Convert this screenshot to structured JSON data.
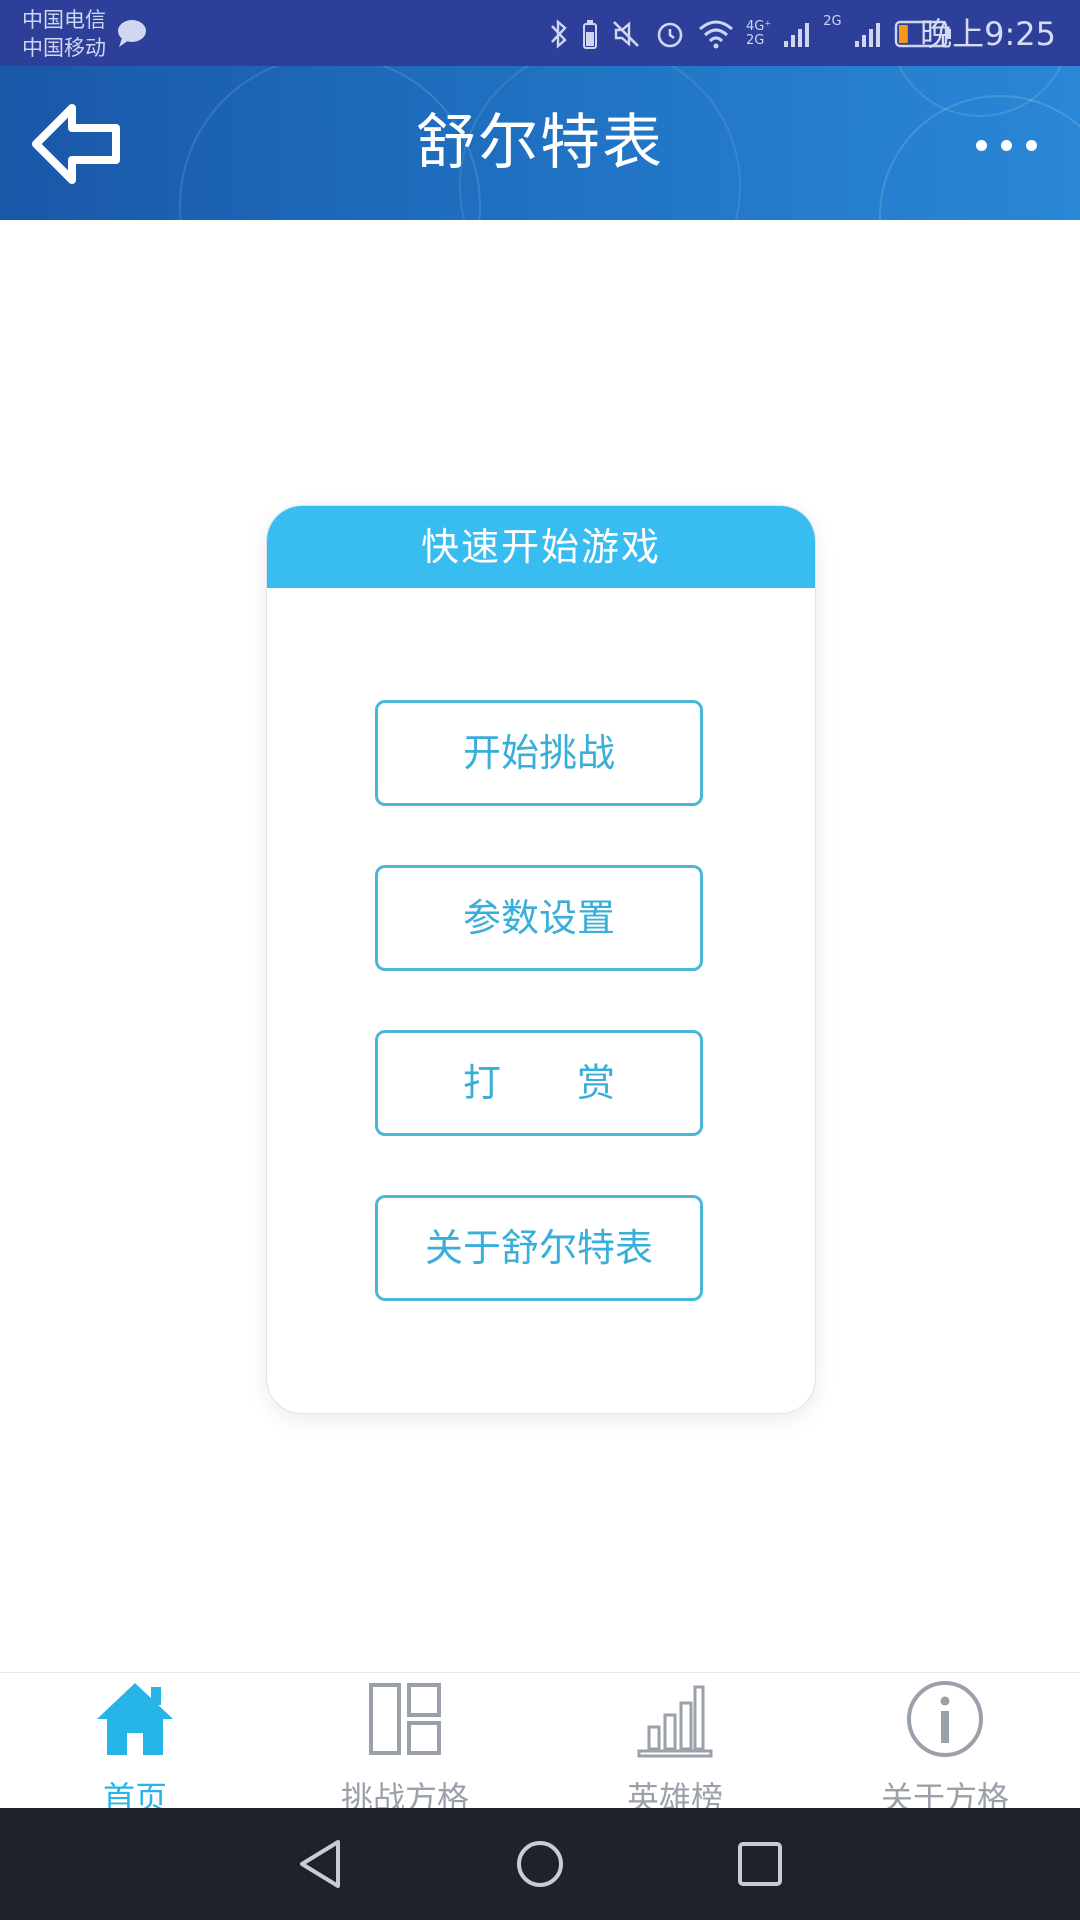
{
  "status_bar": {
    "carrier_1": "中国电信",
    "carrier_2": "中国移动",
    "time": "晚上9:25",
    "network_1": "4G⁺",
    "network_2": "2G",
    "network_3": "2G",
    "icons": [
      "chat-icon",
      "bluetooth-icon",
      "battery-small-icon",
      "mute-icon",
      "alarm-icon",
      "wifi-icon",
      "signal-icon",
      "signal-icon",
      "battery-icon"
    ],
    "battery_level": 0.2
  },
  "header": {
    "title": "舒尔特表",
    "back_icon": "back-arrow-icon",
    "more_icon": "more-dots-icon"
  },
  "card": {
    "title": "快速开始游戏",
    "buttons": [
      {
        "label": "开始挑战"
      },
      {
        "label": "参数设置"
      },
      {
        "label": "打　　赏"
      },
      {
        "label": "关于舒尔特表"
      }
    ]
  },
  "tabs": [
    {
      "label": "首页",
      "icon": "home-icon",
      "active": true
    },
    {
      "label": "挑战方格",
      "icon": "grid-layout-icon",
      "active": false
    },
    {
      "label": "英雄榜",
      "icon": "bar-chart-icon",
      "active": false
    },
    {
      "label": "关于方格",
      "icon": "info-icon",
      "active": false
    }
  ],
  "colors": {
    "status_bar": "#2e3f9a",
    "header_gradient_start": "#1a57a8",
    "header_gradient_end": "#2a87d6",
    "card_header": "#39bdf0",
    "button_border": "#4bb6d8",
    "tab_active": "#26b5e6",
    "tab_inactive": "#9aa1aa",
    "nav_bar": "#1f2229"
  }
}
